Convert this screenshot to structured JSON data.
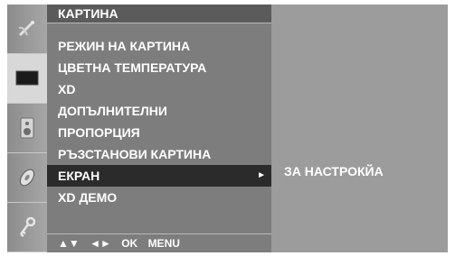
{
  "menu": {
    "title": "КАРТИНА",
    "items": [
      {
        "label": "РЕЖИН НА КАРТИНА",
        "selected": false
      },
      {
        "label": "ЦВЕТНА ТЕМПЕРАТУРА",
        "selected": false
      },
      {
        "label": "XD",
        "selected": false
      },
      {
        "label": "ДОПЪЛНИТЕЛНИ",
        "selected": false
      },
      {
        "label": "ПРОПОРЦИЯ",
        "selected": false
      },
      {
        "label": "РЪЗСТАНОВИ КАРТИНА",
        "selected": false
      },
      {
        "label": "ЕКРАН",
        "selected": true,
        "arrow": "►"
      },
      {
        "label": "XD ДЕМО",
        "selected": false
      }
    ]
  },
  "submenu": {
    "label": "ЗА НАСТРОКЙА"
  },
  "nav_hints": {
    "updown": "▲▼",
    "leftright": "◄►",
    "ok": "OK",
    "menu": "MENU"
  },
  "rail_icons": [
    "satellite-dish-icon",
    "screen-icon",
    "speaker-icon",
    "disc-icon",
    "key-icon"
  ],
  "colors": {
    "selected_bg": "#2b2b2b",
    "menu_bg": "#7d7d7d",
    "submenu_bg": "#9c9c9c",
    "text": "#ffffff"
  }
}
